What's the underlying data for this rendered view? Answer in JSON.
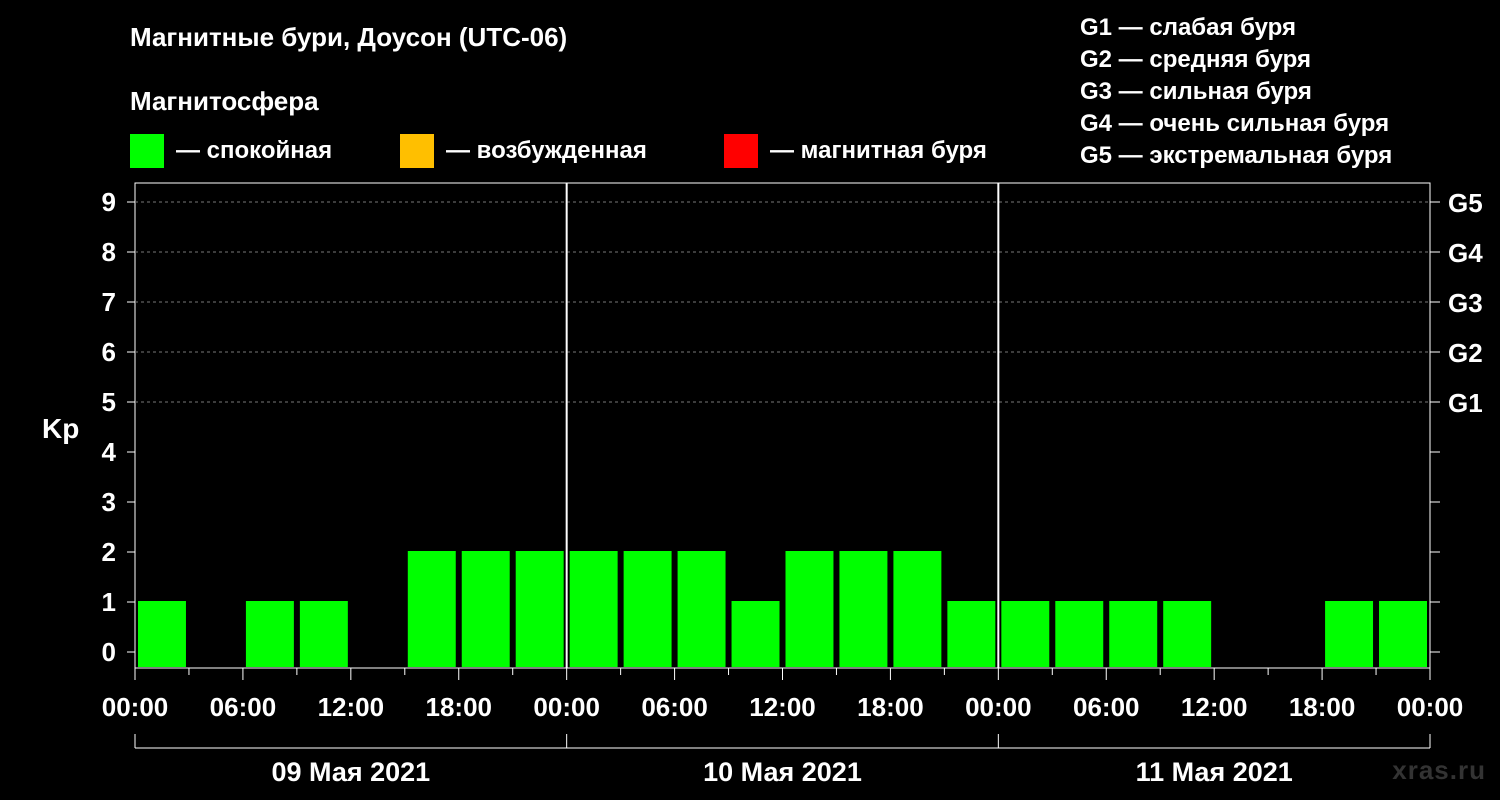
{
  "header": {
    "title": "Магнитные бури, Доусон (UTC-06)",
    "subtitle": "Магнитосфера"
  },
  "legend": [
    {
      "label": "— спокойная",
      "color": "#00ff00"
    },
    {
      "label": "— возбужденная",
      "color": "#ffbf00"
    },
    {
      "label": "— магнитная буря",
      "color": "#ff0000"
    }
  ],
  "g_scale": [
    "G1 — слабая буря",
    "G2 — средняя буря",
    "G3 — сильная буря",
    "G4 — очень сильная буря",
    "G5 — экстремальная буря"
  ],
  "watermark": "xras.ru",
  "chart_data": {
    "type": "bar",
    "ylabel": "Kp",
    "ylim": [
      0,
      9
    ],
    "y_ticks": [
      0,
      1,
      2,
      3,
      4,
      5,
      6,
      7,
      8,
      9
    ],
    "right_ticks": [
      {
        "value": 5,
        "label": "G1"
      },
      {
        "value": 6,
        "label": "G2"
      },
      {
        "value": 7,
        "label": "G3"
      },
      {
        "value": 8,
        "label": "G4"
      },
      {
        "value": 9,
        "label": "G5"
      }
    ],
    "x_tick_labels": [
      "00:00",
      "06:00",
      "12:00",
      "18:00",
      "00:00",
      "06:00",
      "12:00",
      "18:00",
      "00:00",
      "06:00",
      "12:00",
      "18:00",
      "00:00"
    ],
    "days": [
      "09 Мая 2021",
      "10 Мая 2021",
      "11 Мая 2021"
    ],
    "interval_hours": 3,
    "values": [
      1,
      0,
      1,
      1,
      0,
      2,
      2,
      2,
      2,
      2,
      2,
      1,
      2,
      2,
      2,
      1,
      1,
      1,
      1,
      1,
      0,
      0,
      1,
      1
    ],
    "bar_color": "#00ff00",
    "grid": "dashed at G levels 5–9"
  }
}
